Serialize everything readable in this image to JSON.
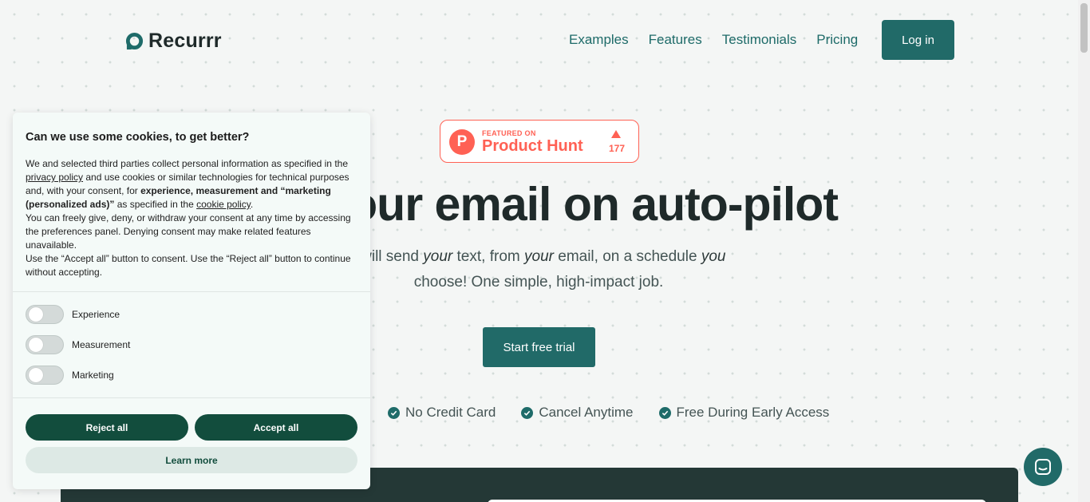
{
  "header": {
    "logo_text": "Recurrr",
    "nav": [
      "Examples",
      "Features",
      "Testimonials",
      "Pricing"
    ],
    "login_label": "Log in"
  },
  "product_hunt": {
    "featured_on": "FEATURED ON",
    "name": "Product Hunt",
    "votes": "177",
    "color": "#ff6154"
  },
  "hero": {
    "title": "our email on auto-pilot",
    "sub_parts": [
      "r will send ",
      "your",
      " text, from ",
      "your",
      " email, on a schedule ",
      "you",
      " choose! One simple, high-impact job."
    ],
    "cta_label": "Start free trial",
    "perks": [
      "No Credit Card",
      "Cancel Anytime",
      "Free During Early Access"
    ]
  },
  "cookie": {
    "title": "Can we use some cookies, to get better?",
    "p1_a": "We and selected third parties collect personal information as specified in the ",
    "p1_link1": "privacy policy",
    "p1_b": " and use cookies or similar technologies for technical purposes and, with your consent, for ",
    "p1_bold": "experience, measurement and “marketing (personalized ads)”",
    "p1_c": " as specified in the ",
    "p1_link2": "cookie policy",
    "p1_d": ".",
    "p2": "You can freely give, deny, or withdraw your consent at any time by accessing the preferences panel. Denying consent may make related features unavailable.",
    "p3": "Use the “Accept all” button to consent. Use the “Reject all” button to continue without accepting.",
    "toggles": [
      {
        "label": "Experience",
        "on": false
      },
      {
        "label": "Measurement",
        "on": false
      },
      {
        "label": "Marketing",
        "on": false
      }
    ],
    "reject_label": "Reject all",
    "accept_label": "Accept all",
    "learn_label": "Learn more"
  },
  "colors": {
    "brand": "#216a68",
    "cookie_button": "#124d3d"
  },
  "icons": {
    "logo": "logo-ring-icon",
    "chat": "chat-icon",
    "check": "check-circle-icon"
  }
}
